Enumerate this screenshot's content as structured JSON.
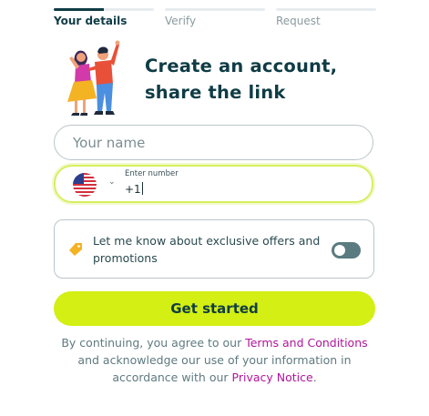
{
  "steps": [
    {
      "label": "Your details",
      "active": true,
      "progress": 0.5
    },
    {
      "label": "Verify",
      "active": false,
      "progress": 0
    },
    {
      "label": "Request",
      "active": false,
      "progress": 0
    }
  ],
  "headline": {
    "line1": "Create an account,",
    "line2": "share the link"
  },
  "name_field": {
    "placeholder": "Your name",
    "value": ""
  },
  "phone_field": {
    "country_icon": "us-flag-icon",
    "label": "Enter number",
    "value": "+1"
  },
  "offers": {
    "text": "Let me know about exclusive offers and promotions",
    "icon": "tag-icon",
    "toggle_on": false
  },
  "cta": {
    "label": "Get started"
  },
  "legal": {
    "prefix": "By continuing, you agree to our ",
    "terms_link": "Terms and Conditions",
    "middle": " and acknowledge our use of your information in accordance with our ",
    "privacy_link": "Privacy Notice",
    "suffix": "."
  },
  "colors": {
    "primary_dark": "#0f3c45",
    "cta": "#d3ef13",
    "link": "#b0169a",
    "focus": "#d6ef5e"
  }
}
